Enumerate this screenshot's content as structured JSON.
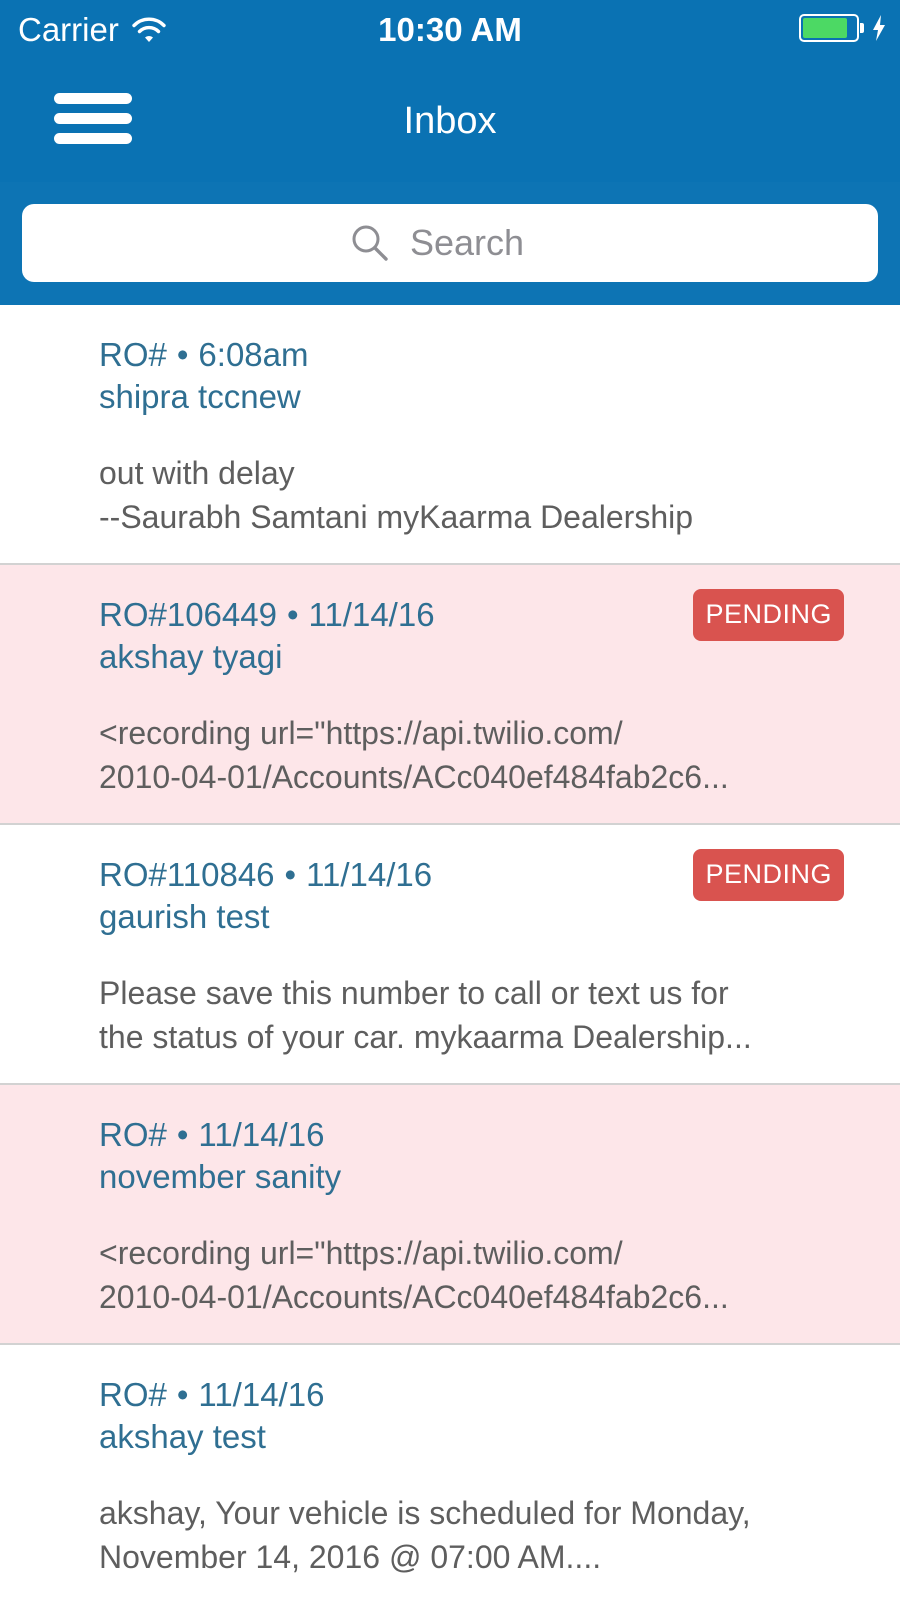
{
  "status_bar": {
    "carrier": "Carrier",
    "time": "10:30 AM",
    "battery_level": 0.85,
    "battery_color": "#4cd964"
  },
  "nav": {
    "title": "Inbox",
    "menu_icon": "hamburger-menu-icon"
  },
  "search": {
    "placeholder": "Search",
    "icon": "search-icon"
  },
  "colors": {
    "header_bg": "#0a72b3",
    "tinted_row_bg": "#fde6e9",
    "badge_bg": "#d9534f",
    "text_accent": "#2f6f92",
    "text_body": "#5e5e5e"
  },
  "messages": [
    {
      "ro": "RO#",
      "dot": "•",
      "time": "6:08am",
      "name": "shipra tccnew",
      "preview": "out with delay\n--Saurabh Samtani myKaarma Dealership",
      "badge": ""
    },
    {
      "ro": "RO#106449",
      "dot": "•",
      "time": "11/14/16",
      "name": "akshay tyagi",
      "preview": "<recording url=\"https://api.twilio.com/\n2010-04-01/Accounts/ACc040ef484fab2c6...",
      "badge": "PENDING"
    },
    {
      "ro": "RO#110846",
      "dot": "•",
      "time": "11/14/16",
      "name": "gaurish test",
      "preview": "Please save this number to call or text us for\nthe status of your car. mykaarma Dealership...",
      "badge": "PENDING"
    },
    {
      "ro": "RO#",
      "dot": "•",
      "time": "11/14/16",
      "name": "november sanity",
      "preview": "<recording url=\"https://api.twilio.com/\n2010-04-01/Accounts/ACc040ef484fab2c6...",
      "badge": ""
    },
    {
      "ro": "RO#",
      "dot": "•",
      "time": "11/14/16",
      "name": "akshay test",
      "preview": " akshay, Your vehicle is scheduled for Monday,\nNovember 14, 2016 @ 07:00 AM....",
      "badge": ""
    }
  ]
}
